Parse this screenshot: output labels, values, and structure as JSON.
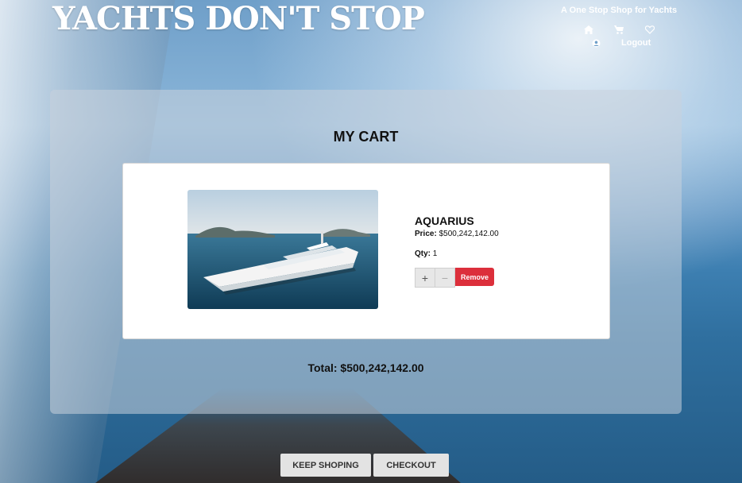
{
  "header": {
    "title": "YACHTS DON'T STOP",
    "tagline": "A One Stop Shop for Yachts",
    "nav": {
      "home_icon": "home-icon",
      "cart_icon": "cart-icon",
      "wishlist_icon": "heart-icon",
      "account_icon": "user-icon",
      "logout_label": "Logout"
    }
  },
  "cart": {
    "title": "MY CART",
    "items": [
      {
        "name": "AQUARIUS",
        "price_label": "Price:",
        "price": "$500,242,142.00",
        "qty_label": "Qty:",
        "qty": "1",
        "increment_label": "+",
        "decrement_label": "−",
        "remove_label": "Remove"
      }
    ],
    "total_text": "Total: $500,242,142.00"
  },
  "actions": {
    "keep_shopping_label": "KEEP SHOPING",
    "checkout_label": "CHECKOUT"
  },
  "colors": {
    "remove_button": "#dc2f3b",
    "panel": "rgba(200,210,220,0.55)"
  }
}
